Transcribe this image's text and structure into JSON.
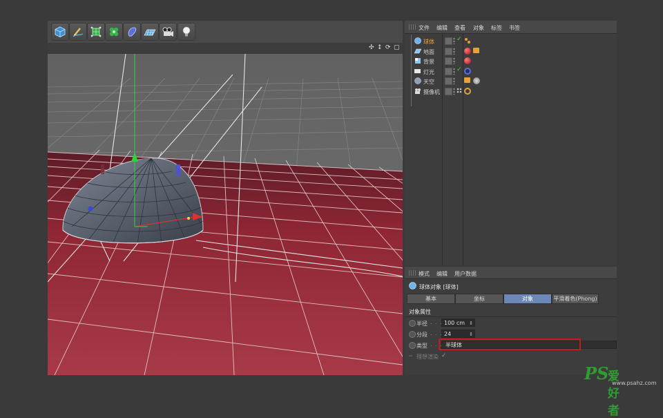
{
  "viewport": {
    "toolbar_icons": [
      "cube-icon",
      "pen-icon",
      "subdivision-icon",
      "cloner-icon",
      "deformer-icon",
      "floor-icon",
      "camera-icon",
      "light-icon"
    ],
    "nav_glyphs": [
      "✣",
      "↕",
      "⟳",
      "▢"
    ]
  },
  "object_manager": {
    "menu": [
      "文件",
      "编辑",
      "查看",
      "对象",
      "标签",
      "书签"
    ],
    "objects": [
      {
        "name": "球体",
        "icon": "sphere-icon",
        "selected": true,
        "enabled": true,
        "tags": [
          "phong-tag"
        ]
      },
      {
        "name": "地面",
        "icon": "floor-icon",
        "selected": false,
        "enabled": false,
        "tags": [
          "material-tag-red",
          "texture-tag"
        ]
      },
      {
        "name": "背景",
        "icon": "background-icon",
        "selected": false,
        "enabled": false,
        "tags": [
          "material-tag-red"
        ]
      },
      {
        "name": "灯光",
        "icon": "light-icon",
        "selected": false,
        "enabled": true,
        "tags": [
          "target-tag"
        ]
      },
      {
        "name": "天空",
        "icon": "sky-icon",
        "selected": false,
        "enabled": false,
        "tags": [
          "texture-tag",
          "sky-material-tag"
        ]
      },
      {
        "name": "摄像机",
        "icon": "camera-icon",
        "selected": false,
        "enabled": false,
        "tags": [
          "protection-tag"
        ]
      }
    ]
  },
  "attributes": {
    "menu": [
      "模式",
      "编辑",
      "用户数据"
    ],
    "object_title": "球体对象 [球体]",
    "tabs": [
      "基本",
      "坐标",
      "对象",
      "平滑着色(Phong)"
    ],
    "active_tab": "对象",
    "section_title": "对象属性",
    "props": {
      "radius": {
        "label": "半径",
        "value": "100 cm"
      },
      "segments": {
        "label": "分段",
        "value": "24"
      },
      "type": {
        "label": "类型",
        "value": "半球体"
      },
      "render_perfect": {
        "label": "理想渲染",
        "value": "✓"
      }
    },
    "dots": ". . ."
  },
  "colors": {
    "floor": "#9b2a38",
    "selected_accent": "#6d87b6",
    "highlight_box": "#c8191e",
    "watermark": "#2f9e32"
  },
  "watermark": {
    "ps": "PS",
    "cn": "爱好者",
    "url": "www.psahz.com"
  }
}
